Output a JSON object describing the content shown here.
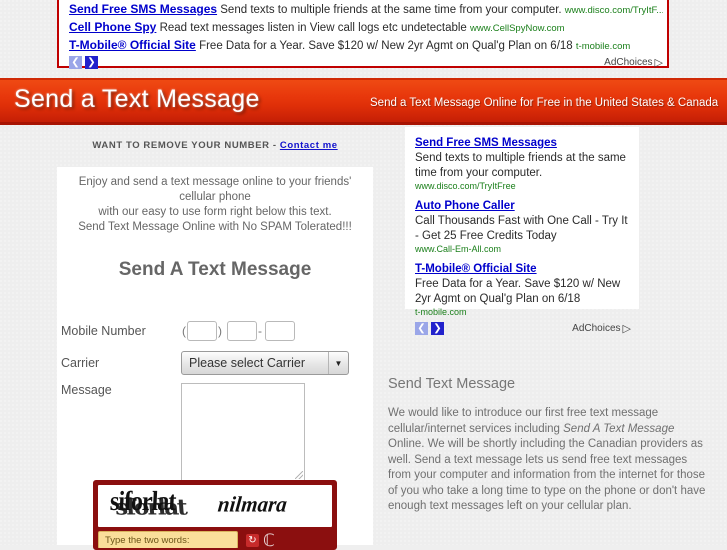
{
  "top_ads": {
    "items": [
      {
        "title": "Send Free SMS Messages",
        "desc": "Send texts to multiple friends at the same time from your computer.",
        "url": "www.disco.com/TryItF..."
      },
      {
        "title": "Cell Phone Spy",
        "desc": "Read text messages listen in View call logs etc undetectable",
        "url": "www.CellSpyNow.com"
      },
      {
        "title": "T-Mobile® Official Site",
        "desc": "Free Data for a Year. Save $120 w/ New 2yr Agmt on Qual'g Plan on 6/18",
        "url": "t-mobile.com"
      }
    ],
    "prev_label": "❮",
    "next_label": "❯",
    "adchoices_label": "AdChoices",
    "adchoices_glyph": "▷"
  },
  "banner": {
    "title": "Send a Text Message",
    "tagline": "Send a Text Message Online for Free in the United States & Canada",
    "color": "#e0330a"
  },
  "remove_line": {
    "text": "WANT TO REMOVE YOUR NUMBER - ",
    "link_label": "Contact me"
  },
  "form": {
    "intro_line1": "Enjoy and send a text message online to your friends' cellular phone",
    "intro_line2": "with our easy to use form right below this text.",
    "intro_line3": "Send Text Message Online with No SPAM Tolerated!!!",
    "heading": "Send A Text Message",
    "mobile_label": "Mobile Number",
    "paren_open": "(",
    "paren_close": ")",
    "dash": "-",
    "area_code_value": "",
    "prefix_value": "",
    "line_value": "",
    "carrier_label": "Carrier",
    "carrier_selected": "Please select Carrier",
    "carrier_arrow": "▼",
    "message_label": "Message",
    "message_value": ""
  },
  "captcha": {
    "word1": "siforlat",
    "word1_overlay": "sforlat",
    "word2": "nilmara",
    "input_placeholder": "Type the two words:",
    "input_value": "",
    "refresh_glyph": "↻",
    "logo_glyph": "ℂ"
  },
  "side_ads": {
    "items": [
      {
        "title": "Send Free SMS Messages",
        "desc": "Send texts to multiple friends at the same time from your computer.",
        "url": "www.disco.com/TryItFree"
      },
      {
        "title": "Auto Phone Caller",
        "desc": "Call Thousands Fast with One Call - Try It - Get 25 Free Credits Today",
        "url": "www.Call-Em-All.com"
      },
      {
        "title": "T-Mobile® Official Site",
        "desc": "Free Data for a Year. Save $120 w/ New 2yr Agmt on Qual'g Plan on 6/18",
        "url": "t-mobile.com"
      }
    ],
    "prev_label": "❮",
    "next_label": "❯",
    "adchoices_label": "AdChoices",
    "adchoices_glyph": "▷"
  },
  "article": {
    "heading": "Send Text Message",
    "body_a": "We would like to introduce our first free text message cellular/internet services including ",
    "body_em": "Send A Text Message",
    "body_b": " Online. We will be shortly including the Canadian providers as well. Send a text message lets us send free text messages from your computer and information from the internet for those of you who take a long time to type on the phone or don't have enough text messages left on your cellular plan."
  }
}
